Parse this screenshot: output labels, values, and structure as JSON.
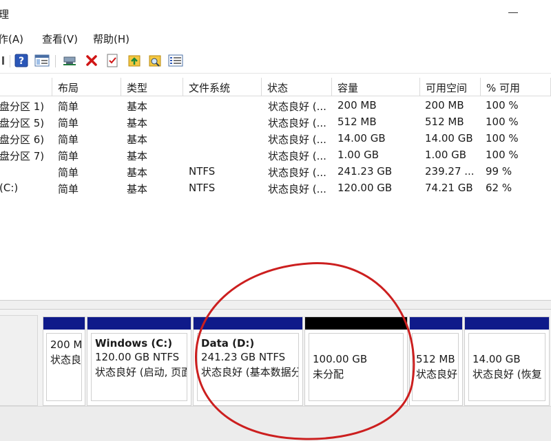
{
  "window": {
    "title_fragment": "理"
  },
  "menu": {
    "items": [
      "作(A)",
      "查看(V)",
      "帮助(H)"
    ]
  },
  "toolbar": {
    "icons": [
      "back-arrow-icon",
      "help-icon",
      "console-tree-icon",
      "connect-disk-icon",
      "delete-icon",
      "properties-check-icon",
      "folder-up-icon",
      "folder-search-icon",
      "list-view-icon"
    ]
  },
  "volumes": {
    "columns": [
      "",
      "布局",
      "类型",
      "文件系统",
      "状态",
      "容量",
      "可用空间",
      "% 可用"
    ],
    "rows": [
      [
        "盘分区 1)",
        "简单",
        "基本",
        "",
        "状态良好 (...",
        "200 MB",
        "200 MB",
        "100 %"
      ],
      [
        "盘分区 5)",
        "简单",
        "基本",
        "",
        "状态良好 (...",
        "512 MB",
        "512 MB",
        "100 %"
      ],
      [
        "盘分区 6)",
        "简单",
        "基本",
        "",
        "状态良好 (...",
        "14.00 GB",
        "14.00 GB",
        "100 %"
      ],
      [
        "盘分区 7)",
        "简单",
        "基本",
        "",
        "状态良好 (...",
        "1.00 GB",
        "1.00 GB",
        "100 %"
      ],
      [
        "",
        "简单",
        "基本",
        "NTFS",
        "状态良好 (...",
        "241.23 GB",
        "239.27 ...",
        "99 %"
      ],
      [
        "(C:)",
        "简单",
        "基本",
        "NTFS",
        "状态良好 (...",
        "120.00 GB",
        "74.21 GB",
        "62 %"
      ]
    ]
  },
  "disk": {
    "partitions": [
      {
        "name": "",
        "size": "200 M",
        "status": "状态良",
        "bar": "#0f1a8a"
      },
      {
        "name": "Windows  (C:)",
        "size": "120.00 GB NTFS",
        "status": "状态良好 (启动, 页面",
        "bar": "#0f1a8a"
      },
      {
        "name": "Data  (D:)",
        "size": "241.23 GB NTFS",
        "status": "状态良好 (基本数据分区)",
        "bar": "#0f1a8a"
      },
      {
        "name": "",
        "size": "100.00 GB",
        "status": "未分配",
        "bar": "#000000"
      },
      {
        "name": "",
        "size": "512 MB",
        "status": "状态良好",
        "bar": "#0f1a8a"
      },
      {
        "name": "",
        "size": "14.00 GB",
        "status": "状态良好 (恢复",
        "bar": "#0f1a8a"
      }
    ]
  },
  "colors": {
    "primary_partition": "#0f1a8a",
    "unallocated": "#000000",
    "annotation_circle": "#cc1f1f"
  }
}
